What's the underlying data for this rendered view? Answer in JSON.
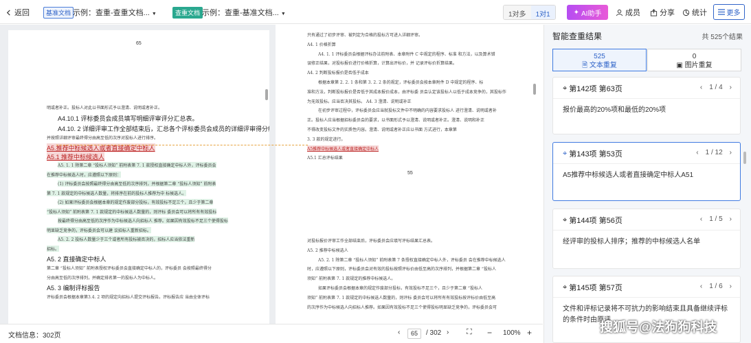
{
  "topbar": {
    "back_label": "返回",
    "base_tag": "基准文档",
    "base_doc": "示例：查重-查重文档...",
    "check_tag": "查重文档",
    "check_doc": "示例：查重-基准文档...",
    "mode_one_to_many": "1对多",
    "mode_one_to_one": "1对1",
    "ai_label": "AI助手",
    "members_label": "成员",
    "share_label": "分享",
    "stats_label": "统计",
    "more_label": "更多"
  },
  "left_page": {
    "page_number": "65",
    "lines": [
      "明或者补正。投标人对此以书面形式予以澄清、说明或者补正。",
      "A4.10.1 评标委员会成员填写明细评审评分汇总表。",
      "A4.10. 2 详细评审工作全部结束后，汇总各个评标委员会成员的详细评审得分结果，",
      "并按照详细评审最终得分由高至低的次序对投标人进行排序。",
      "A5.推荐中标候选人或者直接确定中标人",
      "A5.1 推荐中标候选人",
      "A5. 1. 1 除第二章 “投标人须知” 前附表第 7. 1 款授权直接确定中标人外，评标委员会",
      "在推荐中标候选人时，应遵照以下原则：",
      "(1)  评标委员会按照最终得分由高至低的次序排列，并根据第二章 “投标人须知” 前附表",
      "第 7. 1 款规定的中标候选人数量，将排序在前的投标人推荐为中 标候选人。",
      "(2)  如果评标委员会根据本章的规定作废部分投标，有效投标不足三个，且少于第二章",
      "“投标人须知” 前附表第 7. 1 款规定的中标候选人数量的，则评标 委员会可以将所有有效投标",
      "按最终得分由高至低的次序作为中标候选人向招标人 推荐。如果因有效投标不足三个使得投标",
      "明显缺乏竞争的，评标委员会可以建 议招标人重新招标。",
      "A5. 2. 2 投标人数量少于三个或者所有投标被否决的，招标人应当依法重新",
      "招标。",
      "A5. 2 直接确定中标人",
      "第二章 “投标人须知” 前附表授权评标委员会直接确定中标人的，评标委员 会按照最终得分",
      "分由高至低的次序排列，并确定排名第一的投标人为中标人。",
      "A5. 3 编制评标报告",
      "评标委员会根据本章第3.4. 2 项的规定向招标人提交评标报告。评标报告应 当由全体评标"
    ]
  },
  "right_page": {
    "page_number": "55",
    "lines_top": [
      "只有通过了初步评审、被判定为合格的投标方可进入详细评审。",
      "A4. 1 价格折算",
      "A4. 1. 1 评标委员会根据评标办法前附表、本章附件 C 中规定的程序、标准 和方法，以及算术错",
      "误修正结果，对投标报价进行价格折算，计算出评标价，并 记录评标价折算结果。",
      "A4. 2 判断投标报价是否低于成本",
      "根据本章第 2. 2. 1 条和第 3. 2. 2 条的规定，评标委员会按本章附件 D 中规定的程序、标",
      "准和方法，判断投标报价是否低于其成本报价成本，由评标委 员会认定该投标人以低于成本竞争的，其投标作",
      "为无效投标。应当否决其投标。 A4. 3 澄清、说明或补正",
      "在初步评审过程中，评标委员会应当就投标文件中不明确的内容要求投标人 进行澄清、说明或者补",
      "正。投标人应当根据招标委员会的要求，以书面形式予以澄清、说明或者补正。澄清、说明和补正",
      "不得改变投标文件的实质性内容。澄清、说明或者补正应以书面 方式进行，本章第",
      "3. 3 款的规定进行。",
      "A5推荐中标候选人或者直接确定中标人",
      "A5.1 汇总评标结果"
    ],
    "lines_bottom": [
      "对投标报价评审工作全部结束后，评标委员会应填写评标结果汇总表。",
      "A5. 2 推荐中标候选人",
      "A5. 2. 1 除第二章 “投标人须知” 前附表第 7 条授权直接确定中标人外，评标委员 会在推荐中标候选人",
      "时，应遵照以下原则，评标委员会对有效的投标按照评标价由低至高的次序排列，并根据第二章 “投标人",
      "须知” 前附表第 7. 1 款规定的推荐中标候选人。",
      "如果评标委员会根据本章的规定作废部分投标，有效投标不足三个，且少于第二章 “投标人",
      "须知” 前附表第 7. 1 款规定的中标候选人数量的，则评标 委员会可以将所有有效投标按评标价由低至高",
      "的次序作为中标候选人向招标人推荐。如果因有效投标不足三个使得投标明显缺乏竞争的，评标委员会可"
    ]
  },
  "bottombar": {
    "doc_info": "文档信息：302页",
    "current_page": "65",
    "total_pages": "/ 302",
    "zoom": "100%"
  },
  "panel": {
    "title": "智能查重结果",
    "total": "共 525个结果",
    "tabs": [
      {
        "count": "525",
        "label": "文本重复"
      },
      {
        "count": "0",
        "label": "图片重复"
      }
    ],
    "results": [
      {
        "title": "第142项 第63页",
        "pager": "1 / 4",
        "text": "报价最高的20%项和最低的20%项"
      },
      {
        "title": "第143项 第53页",
        "pager": "1 / 12",
        "text": "A5推荐中标候选人或者直接确定中标人A51"
      },
      {
        "title": "第144项 第56页",
        "pager": "1 / 5",
        "text": "经评审的投标人排序；推荐的中标候选人名单"
      },
      {
        "title": "第145项 第57页",
        "pager": "1 / 6",
        "text": "文件和评标记录将不可抗力的影响结束且具备继续评标的条件时由原评..."
      }
    ]
  },
  "watermark": "搜狐号@法狗狗科技",
  "colors": {
    "accent": "#2f63c8",
    "highlight_red": "#f6d7d7",
    "highlight_green": "#dff2e6",
    "ai_gradient": "#c24ef0"
  }
}
